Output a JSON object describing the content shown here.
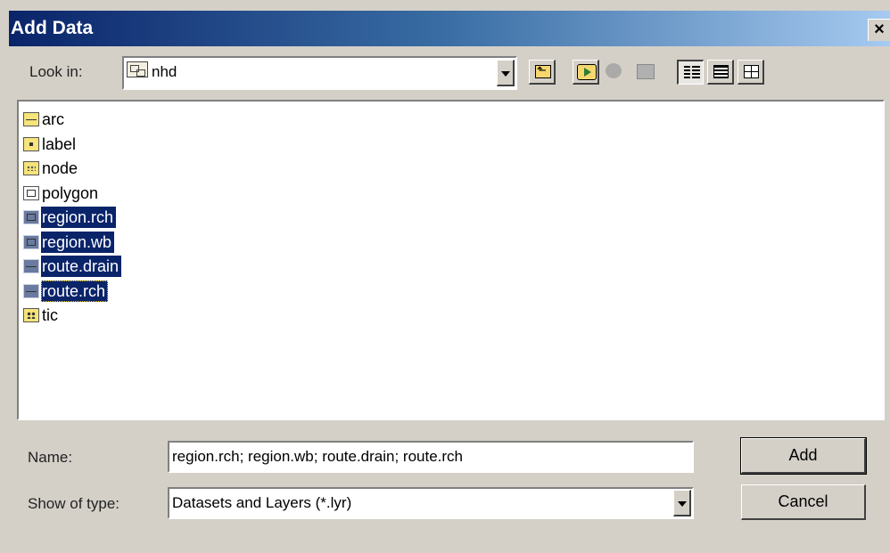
{
  "window": {
    "title": "Add Data",
    "close_glyph": "×"
  },
  "toolbar": {
    "look_in_label": "Look in:",
    "look_in_value": "nhd",
    "buttons": [
      {
        "icon": "up-one-level-icon"
      },
      {
        "icon": "connect-to-folder-icon"
      },
      {
        "icon": "disconnect-folder-icon"
      },
      {
        "icon": "catalog-icon"
      },
      {
        "icon": "list-view-icon"
      },
      {
        "icon": "details-view-icon"
      },
      {
        "icon": "thumbnails-view-icon"
      }
    ]
  },
  "files": [
    {
      "name": "arc",
      "icon": "arc-coverage-icon",
      "selected": false
    },
    {
      "name": "label",
      "icon": "label-coverage-icon",
      "selected": false
    },
    {
      "name": "node",
      "icon": "node-coverage-icon",
      "selected": false
    },
    {
      "name": "polygon",
      "icon": "polygon-coverage-icon",
      "selected": false
    },
    {
      "name": "region.rch",
      "icon": "region-coverage-icon",
      "selected": true
    },
    {
      "name": "region.wb",
      "icon": "region-coverage-icon",
      "selected": true
    },
    {
      "name": "route.drain",
      "icon": "route-coverage-icon",
      "selected": true
    },
    {
      "name": "route.rch",
      "icon": "route-coverage-icon",
      "selected": true
    },
    {
      "name": "tic",
      "icon": "tic-coverage-icon",
      "selected": false
    }
  ],
  "form": {
    "name_label": "Name:",
    "name_value": "region.rch; region.wb; route.drain; route.rch",
    "type_label": "Show of type:",
    "type_value": "Datasets and Layers (*.lyr)"
  },
  "buttons": {
    "add": "Add",
    "cancel": "Cancel"
  },
  "colors": {
    "selection": "#0a246a",
    "dialog_bg": "#d4d0c8",
    "titlebar": "#0a246a"
  }
}
